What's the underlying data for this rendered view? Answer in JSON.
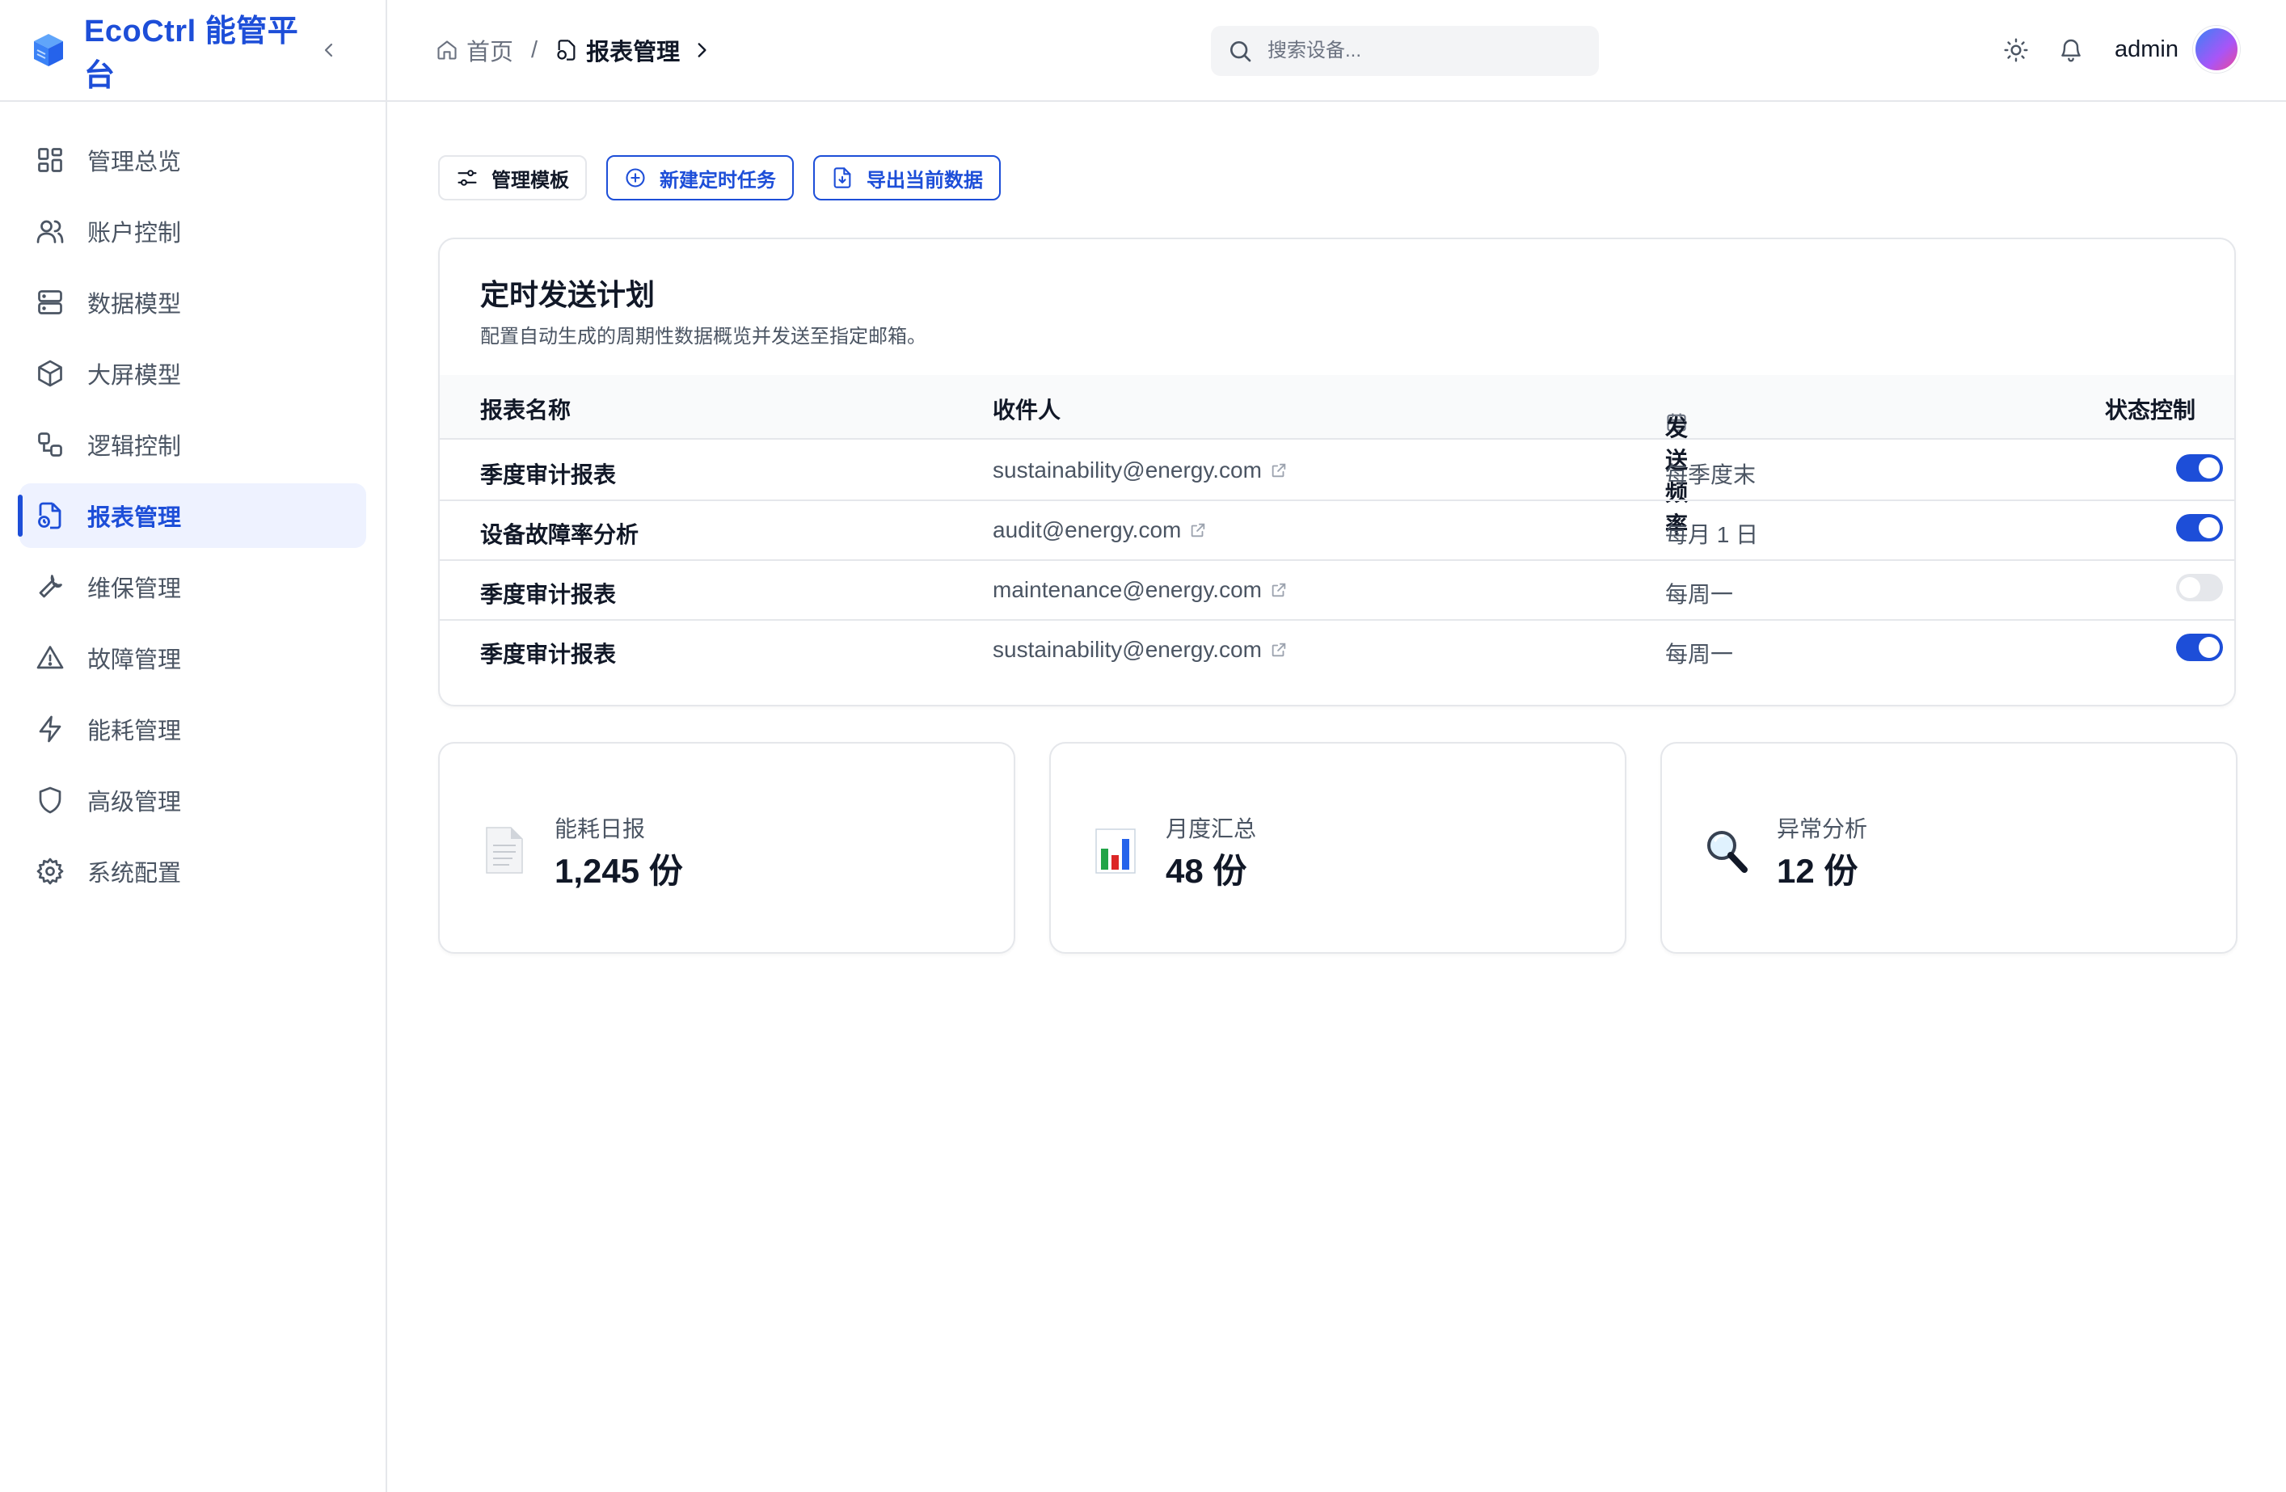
{
  "brand": {
    "name": "EcoCtrl 能管平台",
    "logo_icon": "cube-icon",
    "accent": "#1d4ed8"
  },
  "sidebar": {
    "items": [
      {
        "label": "管理总览",
        "icon": "dashboard-icon",
        "active": false
      },
      {
        "label": "账户控制",
        "icon": "users-icon",
        "active": false
      },
      {
        "label": "数据模型",
        "icon": "server-icon",
        "active": false
      },
      {
        "label": "大屏模型",
        "icon": "box-icon",
        "active": false
      },
      {
        "label": "逻辑控制",
        "icon": "workflow-icon",
        "active": false
      },
      {
        "label": "报表管理",
        "icon": "report-icon",
        "active": true
      },
      {
        "label": "维保管理",
        "icon": "wrench-icon",
        "active": false
      },
      {
        "label": "故障管理",
        "icon": "warning-icon",
        "active": false
      },
      {
        "label": "能耗管理",
        "icon": "bolt-icon",
        "active": false
      },
      {
        "label": "高级管理",
        "icon": "shield-icon",
        "active": false
      },
      {
        "label": "系统配置",
        "icon": "gear-icon",
        "active": false
      }
    ]
  },
  "header": {
    "breadcrumb": {
      "home": "首页",
      "separator": "/",
      "current": "报表管理"
    },
    "search": {
      "placeholder": "搜索设备...",
      "value": ""
    },
    "user": "admin"
  },
  "toolbar": {
    "manage_templates": "管理模板",
    "new_task": "新建定时任务",
    "export": "导出当前数据"
  },
  "schedule": {
    "title": "定时发送计划",
    "description": "配置自动生成的周期性数据概览并发送至指定邮箱。",
    "columns": {
      "name": "报表名称",
      "recipient": "收件人",
      "frequency": "发送频率",
      "status": "状态控制"
    },
    "rows": [
      {
        "name": "季度审计报表",
        "recipient": "sustainability@energy.com",
        "frequency": "每季度末",
        "enabled": true
      },
      {
        "name": "设备故障率分析",
        "recipient": "audit@energy.com",
        "frequency": "每月 1 日",
        "enabled": true
      },
      {
        "name": "季度审计报表",
        "recipient": "maintenance@energy.com",
        "frequency": "每周一",
        "enabled": false
      },
      {
        "name": "季度审计报表",
        "recipient": "sustainability@energy.com",
        "frequency": "每周一",
        "enabled": true
      }
    ]
  },
  "stats": [
    {
      "label": "能耗日报",
      "value": "1,245 份",
      "icon": "document-icon"
    },
    {
      "label": "月度汇总",
      "value": "48 份",
      "icon": "bar-chart-icon"
    },
    {
      "label": "异常分析",
      "value": "12 份",
      "icon": "magnifier-icon"
    }
  ]
}
